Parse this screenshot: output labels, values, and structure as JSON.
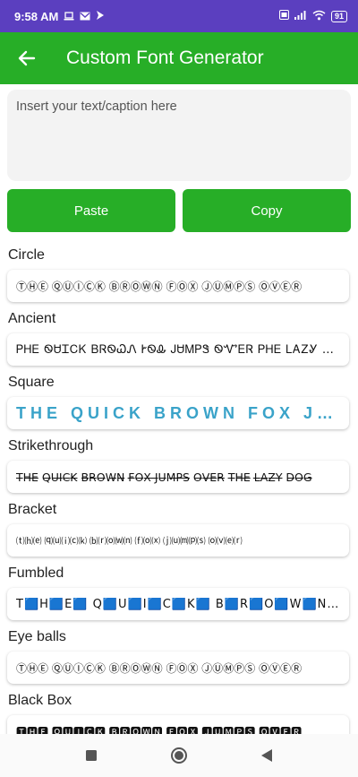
{
  "status_bar": {
    "time": "9:58 AM",
    "left_icons": [
      "laptop-icon",
      "mail-icon",
      "flash-icon"
    ],
    "right_icons": [
      "volte-icon",
      "signal-icon",
      "wifi-icon"
    ],
    "battery": "91"
  },
  "app_bar": {
    "title": "Custom Font Generator",
    "back_icon": "arrow-left-icon"
  },
  "input": {
    "placeholder": "Insert your text/caption here",
    "value": ""
  },
  "buttons": {
    "paste": "Paste",
    "copy": "Copy"
  },
  "styles": [
    {
      "name": "Circle",
      "sample": "ⓉⒽⒺ ⓆⓊⒾⒸⓀ ⒷⓇⓄⓌⓃ ⒻⓄⓍ ⒿⓊⓂⓅⓈ ⓄⓋⒺⓇ"
    },
    {
      "name": "Ancient",
      "sample": "ᏢᎻᎬ ᏫᏌᏆᏟᏦ ᏴᏒᏫᏇᏁ ᎨᏫᎲ ᎫᏌᎷᏢᏕ ᏫᏉᎬᏒ ᏢᎻᎬ ᏞᎪᏃᎽ ᎠᏫᏀ"
    },
    {
      "name": "Square",
      "sample": "THE QUICK BROWN FOX JUMPS"
    },
    {
      "name": "Strikethrough",
      "sample": "T̶H̶E̶ Q̶U̶I̶C̶K̶ B̶R̶O̶W̶N̶ F̶O̶X̶ J̶U̶M̶P̶S̶ O̶V̶E̶R̶ T̶H̶E̶ L̶A̶Z̶Y̶ D̶O̶G̶"
    },
    {
      "name": "Bracket",
      "sample": "⒯⒣⒠ ⒬⒰⒤⒞⒦ ⒝⒭⒪⒲⒩ ⒡⒪⒳ ⒥⒰⒨⒫⒮ ⒪⒱⒠⒭"
    },
    {
      "name": "Fumbled",
      "sample": "T🟦H🟦E🟦 Q🟦U🟦I🟦C🟦K🟦 B🟦R🟦O🟦W🟦N🟦"
    },
    {
      "name": "Eye balls",
      "sample": "ⓉⒽⒺ ⓆⓊⒾⒸⓀ ⒷⓇⓄⓌⓃ ⒻⓄⓍ ⒿⓊⓂⓅⓈ ⓄⓋⒺⓇ"
    },
    {
      "name": "Black Box",
      "sample": "🆃🅷🅴 🆀🆄🅸🅲🅺 🅱🆁🅾🆆🅽 🅵🅾🆇 🅹🆄🅼🅿🆂 🅾🆅🅴🆁"
    }
  ],
  "nav": {
    "icons": [
      "recents-icon",
      "home-icon",
      "back-icon"
    ]
  },
  "colors": {
    "status_bar": "#5b3fbf",
    "accent": "#27ae27",
    "square_text": "#3aa3c9"
  }
}
